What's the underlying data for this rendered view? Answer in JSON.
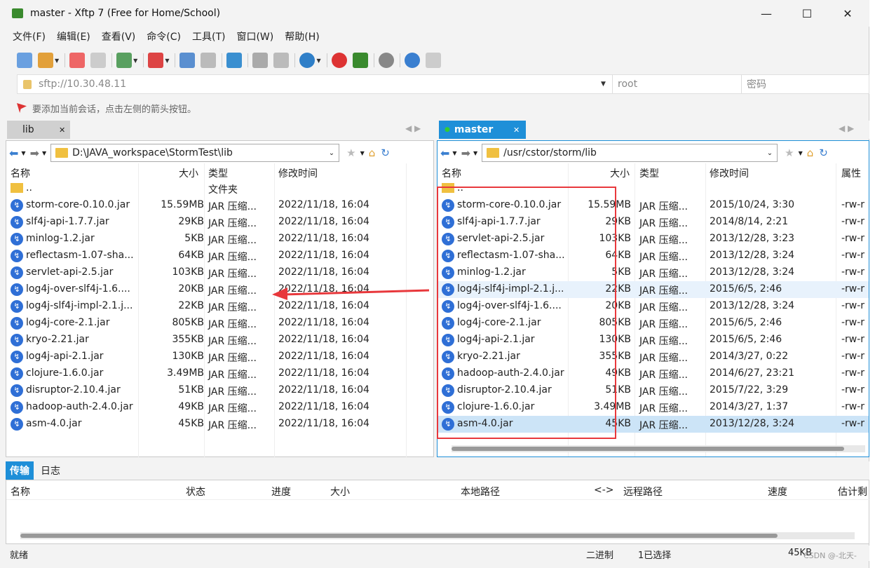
{
  "window": {
    "title": "master - Xftp 7 (Free for Home/School)",
    "minimize": "—",
    "maximize": "☐",
    "close": "✕"
  },
  "menu": [
    "文件(F)",
    "编辑(E)",
    "查看(V)",
    "命令(C)",
    "工具(T)",
    "窗口(W)",
    "帮助(H)"
  ],
  "address": {
    "url": "sftp://10.30.48.11",
    "user_placeholder": "root",
    "password_placeholder": "密码"
  },
  "hint": "要添加当前会话，点击左侧的箭头按钮。",
  "left": {
    "tab": "lib",
    "path": "D:\\JAVA_workspace\\StormTest\\lib",
    "headers": [
      "名称",
      "大小",
      "类型",
      "修改时间"
    ],
    "parent": {
      "name": "..",
      "type": "文件夹"
    },
    "files": [
      {
        "name": "storm-core-0.10.0.jar",
        "size": "15.59MB",
        "type": "JAR 压缩...",
        "mtime": "2022/11/18, 16:04"
      },
      {
        "name": "slf4j-api-1.7.7.jar",
        "size": "29KB",
        "type": "JAR 压缩...",
        "mtime": "2022/11/18, 16:04"
      },
      {
        "name": "minlog-1.2.jar",
        "size": "5KB",
        "type": "JAR 压缩...",
        "mtime": "2022/11/18, 16:04"
      },
      {
        "name": "reflectasm-1.07-sha...",
        "size": "64KB",
        "type": "JAR 压缩...",
        "mtime": "2022/11/18, 16:04"
      },
      {
        "name": "servlet-api-2.5.jar",
        "size": "103KB",
        "type": "JAR 压缩...",
        "mtime": "2022/11/18, 16:04"
      },
      {
        "name": "log4j-over-slf4j-1.6....",
        "size": "20KB",
        "type": "JAR 压缩...",
        "mtime": "2022/11/18, 16:04"
      },
      {
        "name": "log4j-slf4j-impl-2.1.j...",
        "size": "22KB",
        "type": "JAR 压缩...",
        "mtime": "2022/11/18, 16:04"
      },
      {
        "name": "log4j-core-2.1.jar",
        "size": "805KB",
        "type": "JAR 压缩...",
        "mtime": "2022/11/18, 16:04"
      },
      {
        "name": "kryo-2.21.jar",
        "size": "355KB",
        "type": "JAR 压缩...",
        "mtime": "2022/11/18, 16:04"
      },
      {
        "name": "log4j-api-2.1.jar",
        "size": "130KB",
        "type": "JAR 压缩...",
        "mtime": "2022/11/18, 16:04"
      },
      {
        "name": "clojure-1.6.0.jar",
        "size": "3.49MB",
        "type": "JAR 压缩...",
        "mtime": "2022/11/18, 16:04"
      },
      {
        "name": "disruptor-2.10.4.jar",
        "size": "51KB",
        "type": "JAR 压缩...",
        "mtime": "2022/11/18, 16:04"
      },
      {
        "name": "hadoop-auth-2.4.0.jar",
        "size": "49KB",
        "type": "JAR 压缩...",
        "mtime": "2022/11/18, 16:04"
      },
      {
        "name": "asm-4.0.jar",
        "size": "45KB",
        "type": "JAR 压缩...",
        "mtime": "2022/11/18, 16:04"
      }
    ]
  },
  "right": {
    "tab": "master",
    "path": "/usr/cstor/storm/lib",
    "headers": [
      "名称",
      "大小",
      "类型",
      "修改时间",
      "属性"
    ],
    "parent": {
      "name": ".."
    },
    "files": [
      {
        "name": "storm-core-0.10.0.jar",
        "size": "15.59MB",
        "type": "JAR 压缩...",
        "mtime": "2015/10/24, 3:30",
        "attr": "-rw-r"
      },
      {
        "name": "slf4j-api-1.7.7.jar",
        "size": "29KB",
        "type": "JAR 压缩...",
        "mtime": "2014/8/14, 2:21",
        "attr": "-rw-r"
      },
      {
        "name": "servlet-api-2.5.jar",
        "size": "103KB",
        "type": "JAR 压缩...",
        "mtime": "2013/12/28, 3:23",
        "attr": "-rw-r"
      },
      {
        "name": "reflectasm-1.07-sha...",
        "size": "64KB",
        "type": "JAR 压缩...",
        "mtime": "2013/12/28, 3:24",
        "attr": "-rw-r"
      },
      {
        "name": "minlog-1.2.jar",
        "size": "5KB",
        "type": "JAR 压缩...",
        "mtime": "2013/12/28, 3:24",
        "attr": "-rw-r"
      },
      {
        "name": "log4j-slf4j-impl-2.1.j...",
        "size": "22KB",
        "type": "JAR 压缩...",
        "mtime": "2015/6/5, 2:46",
        "attr": "-rw-r"
      },
      {
        "name": "log4j-over-slf4j-1.6....",
        "size": "20KB",
        "type": "JAR 压缩...",
        "mtime": "2013/12/28, 3:24",
        "attr": "-rw-r"
      },
      {
        "name": "log4j-core-2.1.jar",
        "size": "805KB",
        "type": "JAR 压缩...",
        "mtime": "2015/6/5, 2:46",
        "attr": "-rw-r"
      },
      {
        "name": "log4j-api-2.1.jar",
        "size": "130KB",
        "type": "JAR 压缩...",
        "mtime": "2015/6/5, 2:46",
        "attr": "-rw-r"
      },
      {
        "name": "kryo-2.21.jar",
        "size": "355KB",
        "type": "JAR 压缩...",
        "mtime": "2014/3/27, 0:22",
        "attr": "-rw-r"
      },
      {
        "name": "hadoop-auth-2.4.0.jar",
        "size": "49KB",
        "type": "JAR 压缩...",
        "mtime": "2014/6/27, 23:21",
        "attr": "-rw-r"
      },
      {
        "name": "disruptor-2.10.4.jar",
        "size": "51KB",
        "type": "JAR 压缩...",
        "mtime": "2015/7/22, 3:29",
        "attr": "-rw-r"
      },
      {
        "name": "clojure-1.6.0.jar",
        "size": "3.49MB",
        "type": "JAR 压缩...",
        "mtime": "2014/3/27, 1:37",
        "attr": "-rw-r"
      },
      {
        "name": "asm-4.0.jar",
        "size": "45KB",
        "type": "JAR 压缩...",
        "mtime": "2013/12/28, 3:24",
        "attr": "-rw-r"
      }
    ]
  },
  "transfer": {
    "tabs": [
      "传输",
      "日志"
    ],
    "headers": [
      "名称",
      "状态",
      "进度",
      "大小",
      "本地路径",
      "<->",
      "远程路径",
      "速度",
      "估计剩"
    ]
  },
  "statusbar": {
    "left": "就绪",
    "mode": "二进制",
    "selected": "1已选择",
    "size": "45KB"
  },
  "watermark": "CSDN @-北天-"
}
